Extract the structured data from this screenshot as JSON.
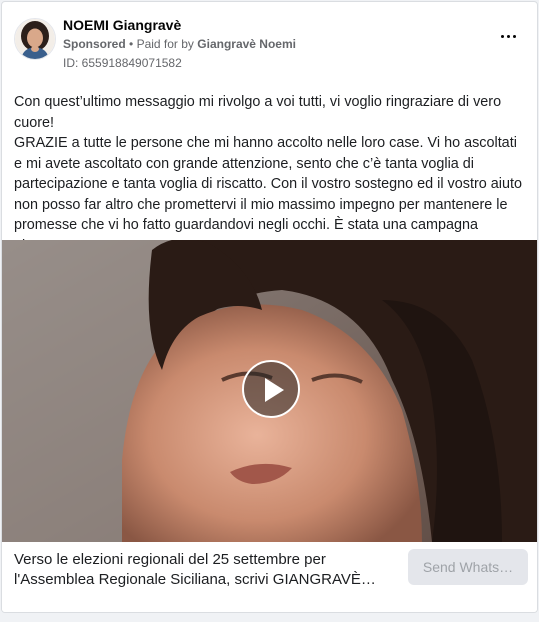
{
  "ad": {
    "page_name": "NOEMI Giangravè",
    "sponsored_label": "Sponsored",
    "separator": "•",
    "paid_for_text": "Paid for by",
    "payer": "Giangravè Noemi",
    "ad_id": "ID: 655918849071582",
    "body": "Con quest’ultimo messaggio mi rivolgo a voi tutti, vi voglio ringraziare di vero cuore!\nGRAZIE a tutte le persone che mi hanno accolto nelle loro case. Vi ho ascoltati e mi avete ascoltato con grande attenzione, sento che c’è tanta voglia di partecipazione e tanta voglia di riscatto. Con il vostro sostegno ed il vostro aiuto non posso far altro che promettervi il mio massimo impegno per mantenere le promesse che vi ho fatto guardandovi negli occhi. È stata una campagna elettora…",
    "link_caption_line1": "Verso le elezioni regionali del 25 settembre per",
    "link_caption_line2": "l'Assemblea Regionale Siciliana, scrivi GIANGRAVÈ…",
    "cta_label": "Send Whats…"
  },
  "icons": {
    "more": "more-options-icon",
    "play": "play-icon"
  },
  "colors": {
    "name": "#050505",
    "secondary_text": "#65676b",
    "body_text": "#1c1e21",
    "cta_bg": "#e4e6eb",
    "cta_text": "#9fa3a8"
  }
}
